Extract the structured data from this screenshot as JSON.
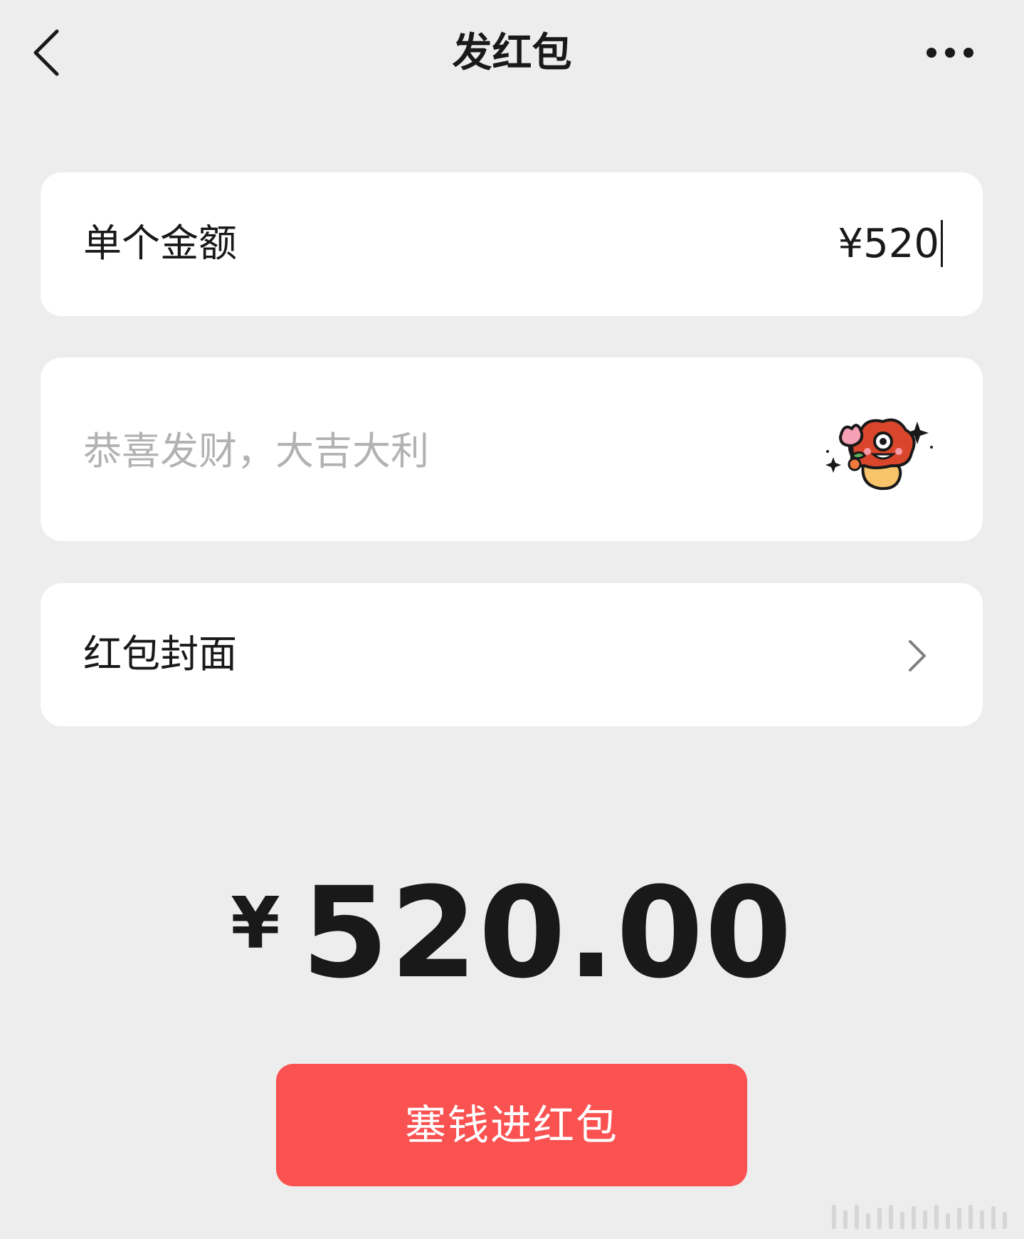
{
  "header": {
    "title": "发红包",
    "back_icon": "chevron-left-icon",
    "more_icon": "ellipsis-icon"
  },
  "amount_row": {
    "label": "单个金额",
    "value": "¥520"
  },
  "greeting_row": {
    "placeholder": "恭喜发财，大吉大利",
    "sticker_icon": "mushroom-flower-sticker-icon"
  },
  "cover_row": {
    "label": "红包封面",
    "chevron_icon": "chevron-right-icon"
  },
  "total": {
    "currency": "¥",
    "value": "520.00"
  },
  "submit": {
    "label": "塞钱进红包"
  },
  "colors": {
    "background": "#ededed",
    "card": "#ffffff",
    "primary_red": "#fa5151",
    "text": "#191919",
    "placeholder": "#b2b2b2"
  }
}
